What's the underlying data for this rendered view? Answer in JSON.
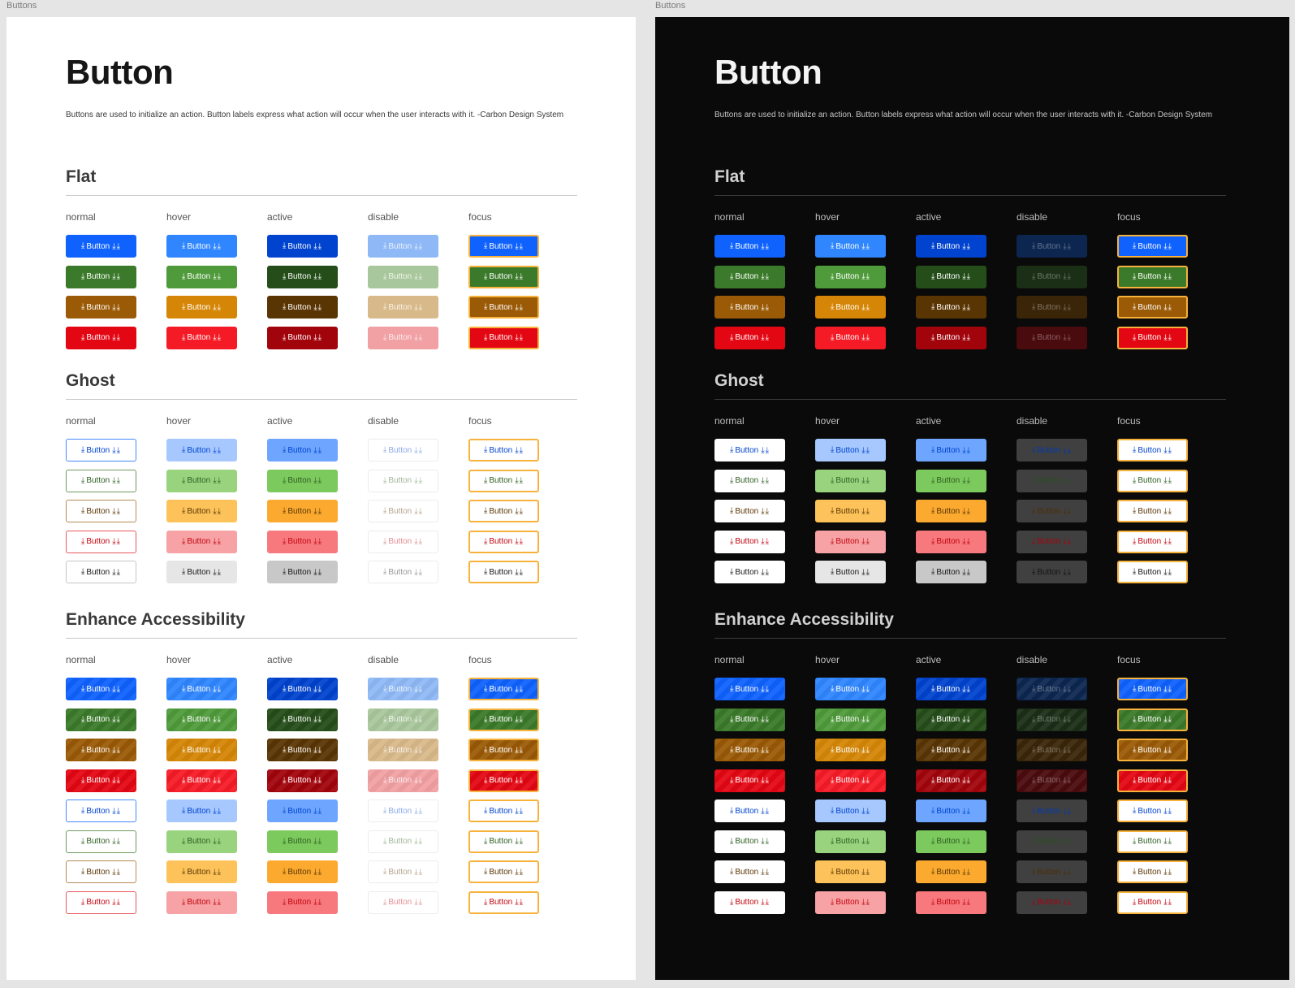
{
  "frames": [
    {
      "label": "Buttons",
      "theme": "light"
    },
    {
      "label": "Buttons",
      "theme": "dark"
    }
  ],
  "title": "Button",
  "description": "Buttons are used to initialize an action. Button labels express what action will occur when the user interacts with it. -Carbon Design System",
  "states": [
    "normal",
    "hover",
    "active",
    "disable",
    "focus"
  ],
  "button_label": "Button",
  "icons": {
    "leading": "download-icon",
    "trailing": "download-icon-pair"
  },
  "focus_color": "#f6b23b",
  "sections": [
    {
      "id": "flat",
      "title": "Flat",
      "kind": "flat",
      "families": [
        "blue",
        "green",
        "amber",
        "red"
      ]
    },
    {
      "id": "ghost",
      "title": "Ghost",
      "kind": "ghost",
      "families": [
        "blue",
        "green",
        "amber",
        "red",
        "neutral"
      ]
    },
    {
      "id": "enhance-accessibility",
      "title": "Enhance Accessibility",
      "kind": "accessible",
      "families": [
        "blue",
        "green",
        "amber",
        "red",
        "blue",
        "green",
        "amber",
        "red"
      ],
      "ghost_rows_from": 4
    }
  ],
  "palette": {
    "blue": {
      "normal": "#0f62fe",
      "hover": "#2f86ff",
      "active": "#0043ce",
      "disable_light": "#8fb9f6",
      "disable_dark": "#0d2650",
      "ghost_text": "#0043ce",
      "ghost_border": "#4589ff",
      "ghost_hover": "#a6c8ff",
      "ghost_active": "#6ea6ff"
    },
    "green": {
      "normal": "#3b7a2a",
      "hover": "#4f9a3a",
      "active": "#244d19",
      "disable_light": "#a9c79c",
      "disable_dark": "#1b2e16",
      "ghost_text": "#2e5e21",
      "ghost_border": "#6e9a60",
      "ghost_hover": "#99d37e",
      "ghost_active": "#7cc95d"
    },
    "amber": {
      "normal": "#9a5a06",
      "hover": "#d58606",
      "active": "#5a3504",
      "disable_light": "#d8b98a",
      "disable_dark": "#3a2508",
      "ghost_text": "#5a3504",
      "ghost_border": "#b78a55",
      "ghost_hover": "#fdc35a",
      "ghost_active": "#fbaa2f"
    },
    "red": {
      "normal": "#e30613",
      "hover": "#f51b26",
      "active": "#a2040c",
      "disable_light": "#f1a0a3",
      "disable_dark": "#4a0b0e",
      "ghost_text": "#c1040f",
      "ghost_border": "#e8585e",
      "ghost_hover": "#f7a2a4",
      "ghost_active": "#f7797d"
    },
    "neutral": {
      "normal": "#ffffff",
      "hover": "#e6e6e6",
      "active": "#c8c8c8",
      "disable_light": "#ffffff",
      "disable_dark": "#4a4a4a",
      "ghost_text": "#161616",
      "ghost_border": "#c6c6c6",
      "ghost_hover": "#e6e6e6",
      "ghost_active": "#c8c8c8"
    }
  }
}
